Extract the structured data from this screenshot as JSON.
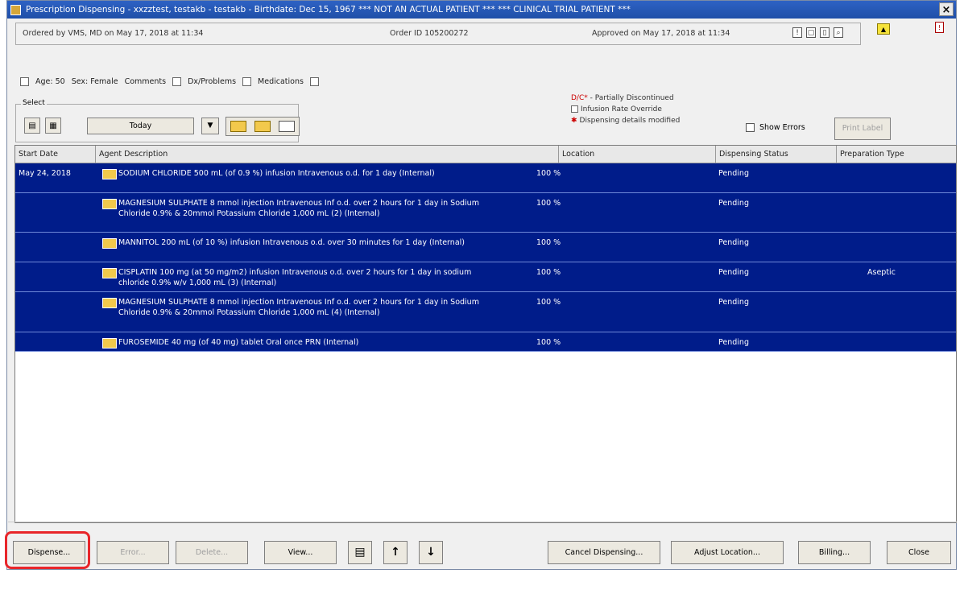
{
  "window": {
    "title": "Prescription Dispensing - xxzztest, testakb - testakb - Birthdate: Dec 15, 1967 *** NOT AN ACTUAL PATIENT *** *** CLINICAL TRIAL PATIENT ***",
    "close_label": "×"
  },
  "order": {
    "ordered_by": "Ordered by VMS, MD on May 17, 2018 at 11:34",
    "order_id": "Order ID 105200272",
    "approved": "Approved on May 17, 2018 at 11:34"
  },
  "patient": {
    "age": "Age: 50",
    "sex": "Sex: Female",
    "comments": "Comments",
    "dx": "Dx/Problems",
    "medications": "Medications"
  },
  "legend": {
    "dc_prefix": "D/C*",
    "dc_text": " - Partially Discontinued",
    "infusion": "Infusion Rate Override",
    "dispensing_mod": "Dispensing details modified"
  },
  "select": {
    "label": "Select",
    "period": "Today"
  },
  "controls": {
    "show_errors": "Show Errors",
    "print_label": "Print Label"
  },
  "columns": [
    "Start Date",
    "Agent Description",
    "Location",
    "Dispensing Status",
    "Preparation Type"
  ],
  "rows": [
    {
      "date": "May 24, 2018",
      "desc": "SODIUM CHLORIDE 500 mL (of 0.9 %) infusion Intravenous o.d. for 1 day (Internal)",
      "pct": "100 %",
      "status": "Pending",
      "prep": ""
    },
    {
      "date": "",
      "desc": "MAGNESIUM SULPHATE 8 mmol injection Intravenous Inf o.d. over 2 hours for 1 day in Sodium Chloride 0.9% & 20mmol Potassium Chloride 1,000 mL (2) (Internal)",
      "pct": "100 %",
      "status": "Pending",
      "prep": ""
    },
    {
      "date": "",
      "desc": "MANNITOL 200 mL (of 10 %) infusion Intravenous o.d. over 30 minutes for 1 day (Internal)",
      "pct": "100 %",
      "status": "Pending",
      "prep": ""
    },
    {
      "date": "",
      "desc": "CISPLATIN 100 mg (at 50 mg/m2) infusion Intravenous o.d. over 2 hours for 1 day in sodium chloride 0.9% w/v 1,000 mL (3) (Internal)",
      "pct": "100 %",
      "status": "Pending",
      "prep": "Aseptic"
    },
    {
      "date": "",
      "desc": "MAGNESIUM SULPHATE 8 mmol injection Intravenous Inf o.d. over 2 hours for 1 day in Sodium Chloride 0.9% & 20mmol Potassium Chloride 1,000 mL (4) (Internal)",
      "pct": "100 %",
      "status": "Pending",
      "prep": ""
    },
    {
      "date": "",
      "desc": "FUROSEMIDE 40 mg (of 40 mg) tablet Oral once PRN (Internal)",
      "pct": "100 %",
      "status": "Pending",
      "prep": ""
    }
  ],
  "footer": {
    "dispense": "Dispense...",
    "error": "Error...",
    "delete": "Delete...",
    "view": "View...",
    "up": "↑",
    "down": "↓",
    "cancel_dispensing": "Cancel Dispensing...",
    "adjust_location": "Adjust Location...",
    "billing": "Billing...",
    "close": "Close"
  }
}
